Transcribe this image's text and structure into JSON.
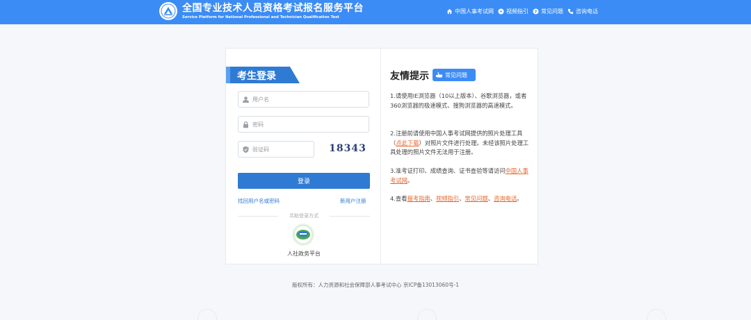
{
  "header": {
    "title": "全国专业技术人员资格考试报名服务平台",
    "subtitle": "Service Platform for National Professional and Technician Qualification Test",
    "nav": [
      {
        "label": "中国人事考试网",
        "icon": "home-icon"
      },
      {
        "label": "视频指引",
        "icon": "play-icon"
      },
      {
        "label": "常见问题",
        "icon": "question-icon"
      },
      {
        "label": "咨询电话",
        "icon": "phone-icon"
      }
    ]
  },
  "login": {
    "tab_label": "考生登录",
    "username_placeholder": "用户名",
    "password_placeholder": "密码",
    "captcha_placeholder": "验证码",
    "captcha_text": "18343",
    "submit_label": "登录",
    "forgot_label": "找回用户名或密码",
    "register_label": "新用户注册",
    "share_label": "共助登录方式",
    "partner_label": "人社政务平台"
  },
  "tips": {
    "title": "友情提示",
    "faq_label": "常见问题",
    "item1": "1.请使用IE浏览器（10以上版本）、谷歌浏览器，或者360浏览器的极速模式、搜狗浏览器的高速模式。",
    "item2_pre": "2.注册前请使用中国人事考试网提供的照片处理工具（",
    "item2_link": "点此下载",
    "item2_post": "）对照片文件进行处理。未经该照片处理工具处理的照片文件无法用于注册。",
    "item3_pre": "3.准考证打印、成绩查询、证书查验等请访问",
    "item3_link": "中国人事考试网",
    "item3_post": "。",
    "item4_pre": "4.查看",
    "item4_link1": "报考指南",
    "item4_sep1": "、",
    "item4_link2": "视频指引",
    "item4_sep2": "、",
    "item4_link3": "常见问题",
    "item4_sep3": "、",
    "item4_link4": "咨询电话",
    "item4_post": "。"
  },
  "footer": {
    "text": "版权所有：人力资源和社会保障部人事考试中心 京ICP备13013060号-1"
  },
  "colors": {
    "header_blue": "#3c8cf5",
    "button_blue": "#2f7bd4",
    "link_orange": "#e8672c"
  }
}
